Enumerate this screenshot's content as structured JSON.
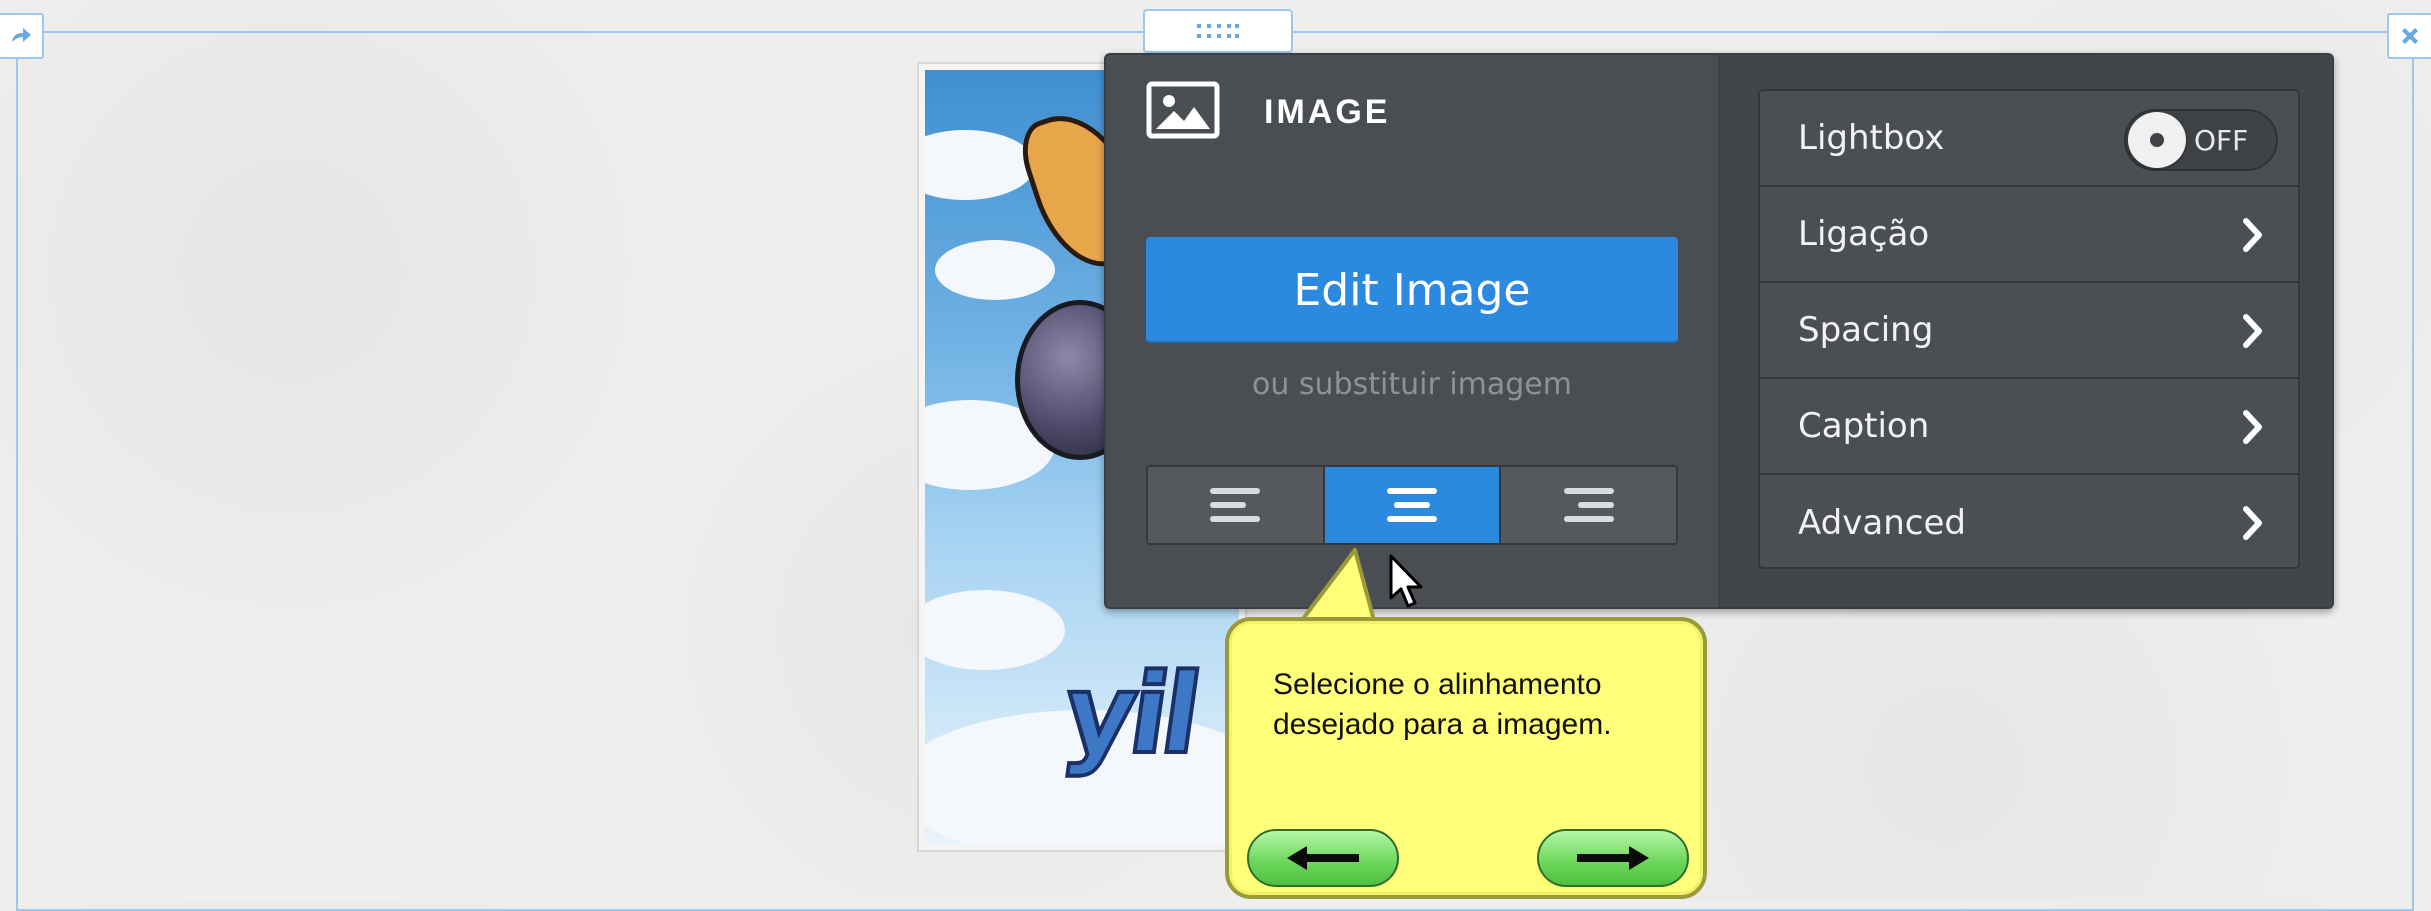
{
  "panel": {
    "title": "IMAGE",
    "edit_button": "Edit Image",
    "replace_link": "ou substituir imagem",
    "alignment": {
      "options": [
        "align-left",
        "align-center",
        "align-right"
      ],
      "selected": "align-center"
    },
    "options": [
      {
        "label": "Lightbox",
        "control": "toggle",
        "toggle_text": "OFF"
      },
      {
        "label": "Ligação",
        "control": "chevron"
      },
      {
        "label": "Spacing",
        "control": "chevron"
      },
      {
        "label": "Caption",
        "control": "chevron"
      },
      {
        "label": "Advanced",
        "control": "chevron"
      }
    ]
  },
  "tooltip": {
    "text": "Selecione o alinhamento desejado para a imagem.",
    "prev_icon": "arrow-left-icon",
    "next_icon": "arrow-right-icon"
  },
  "frame": {
    "left_handle_icon": "arrow-right-icon",
    "right_handle_icon": "close-icon",
    "top_handle_icon": "drag-dots-icon"
  },
  "image_logo_text": "yil",
  "colors": {
    "accent": "#2c89e0",
    "panel_bg": "#4a4e53",
    "frame_border": "#9cc8f0",
    "tooltip_bg": "#ffff7a",
    "nav_green": "#6fd85e"
  }
}
